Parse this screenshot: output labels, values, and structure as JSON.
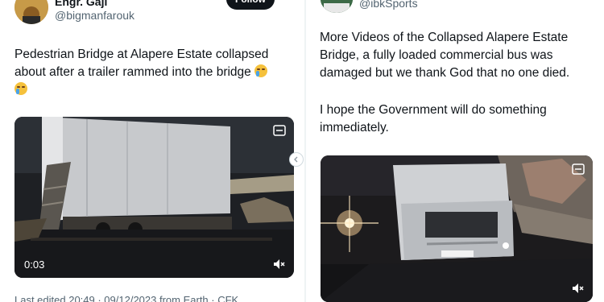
{
  "left_tweet": {
    "display_name": "Engr. Gaji",
    "handle": "@bigmanfarouk",
    "follow_label": "Follow",
    "text": "Pedestrian Bridge at Alapere Estate collapsed about after a trailer rammed into the bridge",
    "video": {
      "duration": "0:03"
    },
    "edited_note": "Last edited 20:49 · 09/12/2023 from Earth · CFK"
  },
  "right_tweet": {
    "handle": "@ibkSports",
    "text_1": "More Videos of the Collapsed Alapere Estate Bridge, a fully loaded commercial bus was damaged but we thank God that no one died.",
    "text_2": "I hope the Government will do something immediately."
  },
  "icons": {
    "emoji": "loudly-crying-face-icon",
    "volume": "volume-icon",
    "gif": "media-badge-icon"
  }
}
